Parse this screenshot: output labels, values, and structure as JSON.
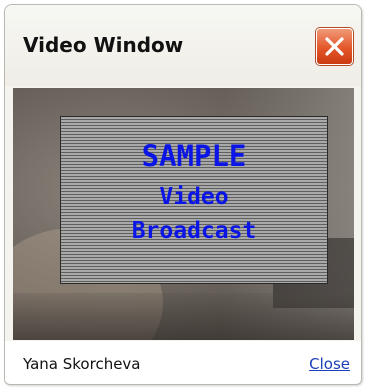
{
  "window": {
    "title": "Video Window",
    "close_icon": "close-x-icon",
    "close_button_color": "#e3572a"
  },
  "video": {
    "overlay_line1": "SAMPLE",
    "overlay_line2": "Video",
    "overlay_line3": "Broadcast",
    "overlay_text_color": "#0b16e6"
  },
  "footer": {
    "user_name": "Yana Skorcheva",
    "close_link": "Close",
    "link_color": "#1c3fb8"
  }
}
